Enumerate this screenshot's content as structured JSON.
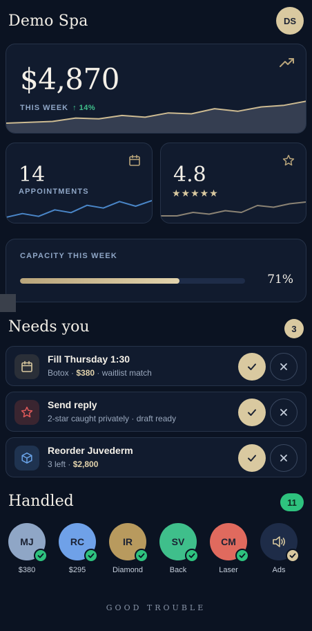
{
  "header": {
    "brand": "Demo Spa",
    "avatar_initials": "DS"
  },
  "revenue": {
    "amount": "$4,870",
    "label": "THIS WEEK",
    "delta": "↑ 14%",
    "trend_icon": "trending-up-icon",
    "spark": [
      8,
      9,
      10,
      14,
      13,
      17,
      15,
      20,
      19,
      25,
      22,
      27,
      29,
      34
    ]
  },
  "appointments": {
    "value": "14",
    "label": "APPOINTMENTS",
    "icon": "calendar-icon",
    "spark": [
      8,
      12,
      9,
      16,
      13,
      21,
      18,
      25,
      20,
      26
    ]
  },
  "rating": {
    "value": "4.8",
    "stars": "★★★★★",
    "icon": "star-icon",
    "spark": [
      10,
      10,
      12,
      11,
      13,
      12,
      16,
      15,
      17,
      18
    ]
  },
  "capacity": {
    "label": "CAPACITY THIS WEEK",
    "percent_text": "71%",
    "fraction": 0.71
  },
  "needs": {
    "title": "Needs you",
    "count": "3",
    "items": [
      {
        "title": "Fill Thursday 1:30",
        "detail_pre": "Botox ·",
        "detail_bold": "$380",
        "detail_post": "· waitlist match",
        "icon": "calendar-icon",
        "icon_color": "#d9c9a0",
        "icon_bg": "#2a2f38"
      },
      {
        "title": "Send reply",
        "detail_pre": "2-star caught privately · draft ready",
        "detail_bold": "",
        "detail_post": "",
        "icon": "star-icon",
        "icon_color": "#e05a5a",
        "icon_bg": "#3a2530"
      },
      {
        "title": "Reorder Juvederm",
        "detail_pre": "3 left ·",
        "detail_bold": "$2,800",
        "detail_post": "",
        "icon": "box-icon",
        "icon_color": "#6aa3e8",
        "icon_bg": "#1f3350"
      }
    ]
  },
  "handled": {
    "title": "Handled",
    "count": "11",
    "items": [
      {
        "initials": "MJ",
        "label": "$380",
        "bg": "#8fa6c6",
        "check": "#2ec27e"
      },
      {
        "initials": "RC",
        "label": "$295",
        "bg": "#6fa1e8",
        "check": "#2ec27e"
      },
      {
        "initials": "IR",
        "label": "Diamond",
        "bg": "#b89a5e",
        "check": "#2ec27e"
      },
      {
        "initials": "SV",
        "label": "Back",
        "bg": "#3fbf8b",
        "check": "#2ec27e"
      },
      {
        "initials": "CM",
        "label": "Laser",
        "bg": "#e06a5e",
        "check": "#2ec27e"
      },
      {
        "initials": "",
        "label": "Ads",
        "bg": "#1e2c48",
        "check": "#d9c9a0",
        "icon": "megaphone-icon"
      }
    ]
  },
  "footer": {
    "brand": "GOOD TROUBLE"
  },
  "colors": {
    "accent": "#d9c9a0",
    "success": "#2ec27e",
    "background": "#0b1322",
    "card": "#111b2e"
  }
}
